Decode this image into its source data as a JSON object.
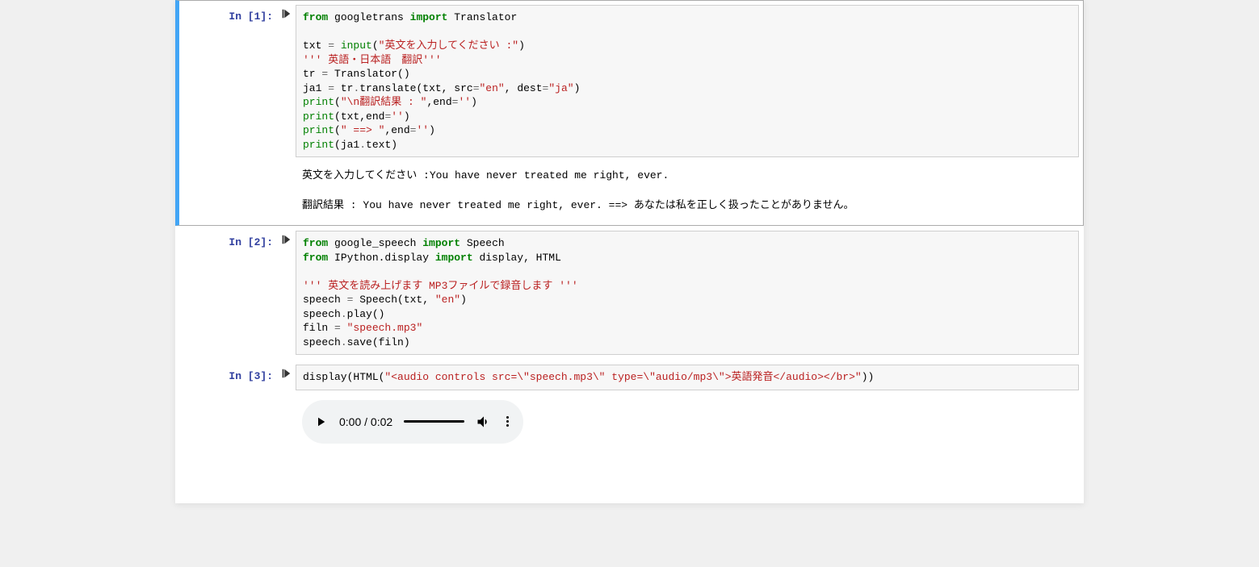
{
  "cells": {
    "cell1": {
      "prompt": "In [1]:",
      "code": {
        "l1_from": "from",
        "l1_mod": " googletrans ",
        "l1_import": "import",
        "l1_name": " Translator",
        "l3_var": "txt ",
        "l3_op": "=",
        "l3_fn": " input",
        "l3_p1": "(",
        "l3_str": "\"英文を入力してください :\"",
        "l3_p2": ")",
        "l4_str": "''' 英語・日本語　翻訳'''",
        "l5": "tr ",
        "l5_op": "=",
        "l5b": " Translator()",
        "l6a": "ja1 ",
        "l6_op": "=",
        "l6b": " tr",
        "l6c": ".",
        "l6d": "translate(txt, src",
        "l6_op2": "=",
        "l6_str1": "\"en\"",
        "l6e": ", dest",
        "l6_op3": "=",
        "l6_str2": "\"ja\"",
        "l6f": ")",
        "l7_fn": "print",
        "l7a": "(",
        "l7_str": "\"\\n翻訳結果 : \"",
        "l7b": ",end",
        "l7_op": "=",
        "l7_str2": "''",
        "l7c": ")",
        "l8_fn": "print",
        "l8a": "(txt,end",
        "l8_op": "=",
        "l8_str": "''",
        "l8b": ")",
        "l9_fn": "print",
        "l9a": "(",
        "l9_str": "\" ==> \"",
        "l9b": ",end",
        "l9_op": "=",
        "l9_str2": "''",
        "l9c": ")",
        "l10_fn": "print",
        "l10a": "(ja1",
        "l10b": ".",
        "l10c": "text)"
      },
      "output": "英文を入力してください :You have never treated me right, ever.\n\n翻訳結果 : You have never treated me right, ever. ==> あなたは私を正しく扱ったことがありません。"
    },
    "cell2": {
      "prompt": "In [2]:",
      "code": {
        "l1_from": "from",
        "l1_mod": " google_speech ",
        "l1_import": "import",
        "l1_name": " Speech",
        "l2_from": "from",
        "l2_mod": " IPython.display ",
        "l2_import": "import",
        "l2_name": " display, HTML",
        "l4_str": "''' 英文を読み上げます MP3ファイルで録音します '''",
        "l5a": "speech ",
        "l5_op": "=",
        "l5b": " Speech(txt, ",
        "l5_str": "\"en\"",
        "l5c": ")",
        "l6a": "speech",
        "l6b": ".",
        "l6c": "play()",
        "l7a": "filn ",
        "l7_op": "=",
        "l7_str": " \"speech.mp3\"",
        "l8a": "speech",
        "l8b": ".",
        "l8c": "save(filn)"
      }
    },
    "cell3": {
      "prompt": "In [3]:",
      "code": {
        "l1a": "display(HTML(",
        "l1_str": "\"<audio controls src=\\\"speech.mp3\\\" type=\\\"audio/mp3\\\">英語発音</audio></br>\"",
        "l1b": "))"
      },
      "audio": {
        "time": "0:00 / 0:02"
      }
    }
  }
}
